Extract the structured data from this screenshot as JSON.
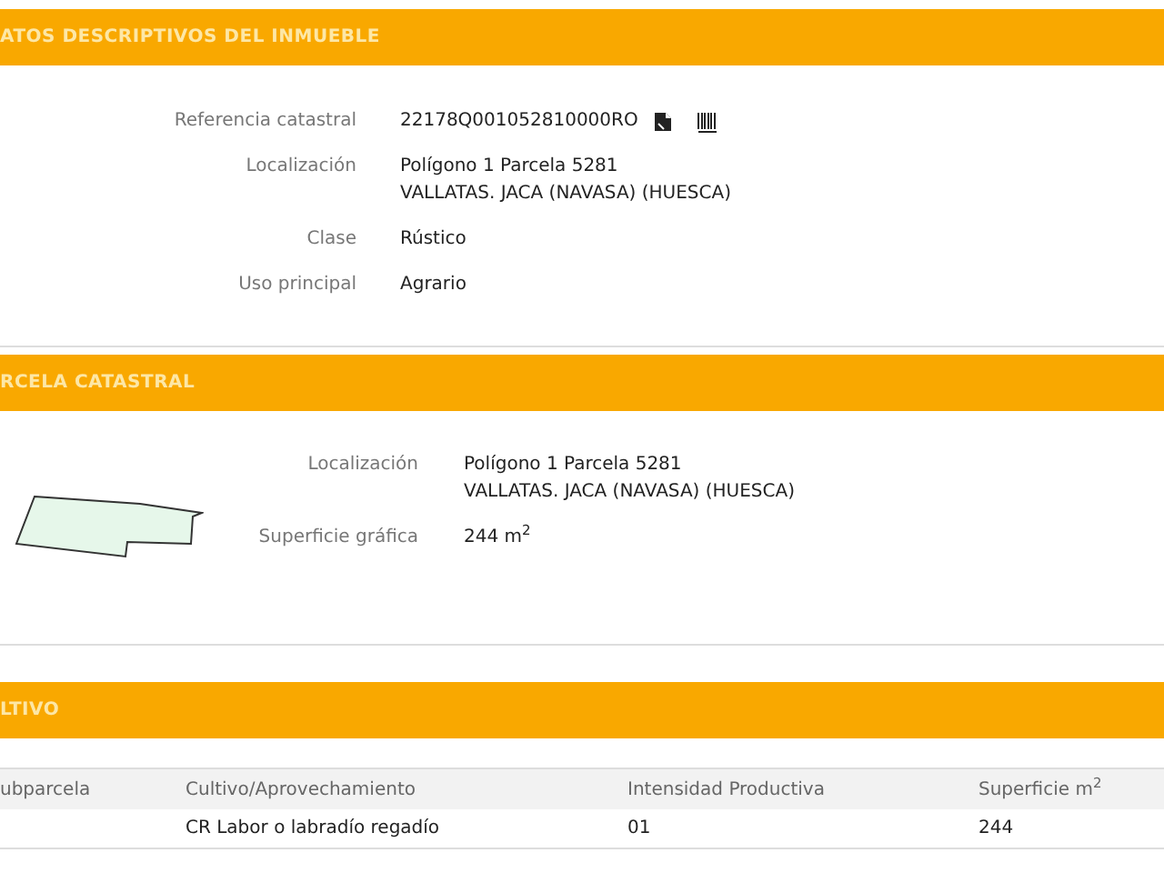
{
  "sections": [
    {
      "title": "ATOS DESCRIPTIVOS DEL INMUEBLE",
      "kind": "fields",
      "fields": [
        {
          "label": "Referencia catastral",
          "lines": [
            "22178Q001052810000RO"
          ],
          "icons": true
        },
        {
          "label": "Localización",
          "lines": [
            "Polígono 1 Parcela 5281",
            "VALLATAS. JACA (NAVASA) (HUESCA)"
          ]
        },
        {
          "label": "Clase",
          "lines": [
            "Rústico"
          ]
        },
        {
          "label": "Uso principal",
          "lines": [
            "Agrario"
          ]
        }
      ]
    },
    {
      "title": "RCELA CATASTRAL",
      "kind": "parcel",
      "fields": [
        {
          "label": "Localización",
          "lines": [
            "Polígono 1 Parcela 5281",
            "VALLATAS. JACA (NAVASA) (HUESCA)"
          ]
        },
        {
          "label": "Superficie gráfica",
          "lines": [
            "244 m$^{2}$"
          ]
        }
      ]
    },
    {
      "title": "LTIVO",
      "kind": "table",
      "columns": [
        "ubparcela",
        "Cultivo/Aprovechamiento",
        "Intensidad Productiva",
        "Superficie m$^{2}$"
      ],
      "rows": [
        [
          "",
          "CR Labor o labradío regadío",
          "01",
          "244"
        ]
      ]
    }
  ]
}
